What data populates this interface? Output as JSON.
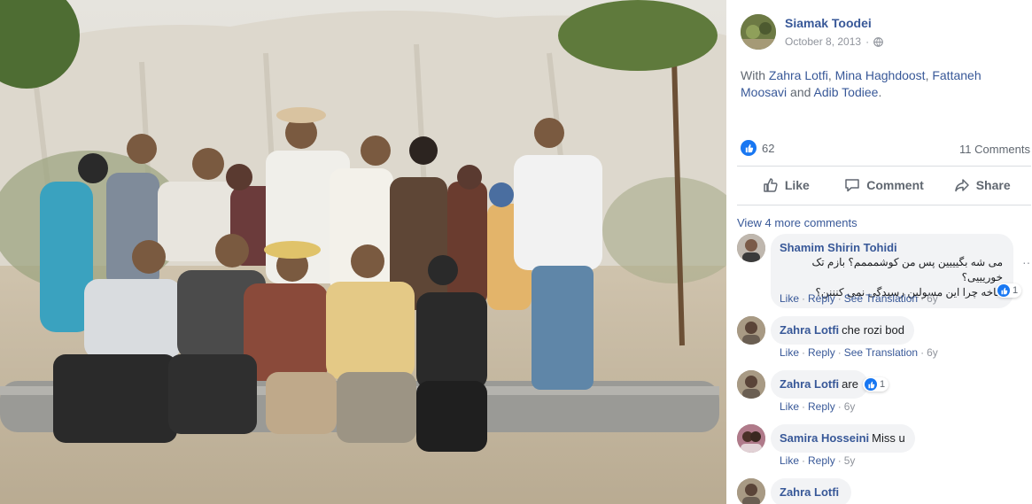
{
  "post": {
    "author": "Siamak Toodei",
    "date": "October 8, 2013",
    "privacy_icon": "globe-icon",
    "with_prefix": "With ",
    "tagged": [
      "Zahra Lotfi",
      "Mina Haghdoost",
      "Fattaneh Moosavi",
      "Adib Todiee"
    ],
    "sep1": ", ",
    "sep2": ", ",
    "sep3": " and ",
    "end": ".",
    "reaction_count": "62",
    "comments_count": "11 Comments"
  },
  "actions": {
    "like": "Like",
    "comment": "Comment",
    "share": "Share"
  },
  "view_more": "View 4 more comments",
  "comments": [
    {
      "name": "Shamim Shirin Tohidi",
      "text_line1": "می شه بگیییین پس من کوشمممم؟ بازم تک خوریییی؟",
      "text_line2": "عاخه چرا این مسولین رسیدگی نمی کنننن؟",
      "like": "Like",
      "reply": "Reply",
      "translation": "See Translation",
      "time": "6y",
      "reactions": "1"
    },
    {
      "name": "Zahra Lotfi",
      "text": "che rozi bod",
      "like": "Like",
      "reply": "Reply",
      "translation": "See Translation",
      "time": "6y"
    },
    {
      "name": "Zahra Lotfi",
      "text": "are",
      "like": "Like",
      "reply": "Reply",
      "time": "6y",
      "reactions": "1"
    },
    {
      "name": "Samira Hosseini",
      "text": "Miss u",
      "like": "Like",
      "reply": "Reply",
      "time": "5y"
    },
    {
      "name": "Zahra Lotfi"
    }
  ],
  "colors": {
    "link": "#385898",
    "meta": "#90949c",
    "like_blue": "#1877f2",
    "bubble": "#f2f3f5"
  }
}
